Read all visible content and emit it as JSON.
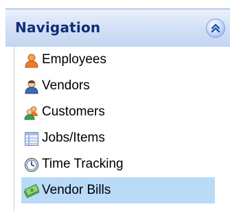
{
  "header": {
    "title": "Navigation",
    "collapse_icon": "double-chevron-up-icon"
  },
  "items": [
    {
      "label": "Employees",
      "icon": "person-orange-icon",
      "selected": false
    },
    {
      "label": "Vendors",
      "icon": "person-blue-icon",
      "selected": false
    },
    {
      "label": "Customers",
      "icon": "people-group-icon",
      "selected": false
    },
    {
      "label": "Jobs/Items",
      "icon": "list-table-icon",
      "selected": false
    },
    {
      "label": "Time Tracking",
      "icon": "clock-icon",
      "selected": false
    },
    {
      "label": "Vendor Bills",
      "icon": "money-bills-icon",
      "selected": true
    }
  ],
  "colors": {
    "header_text": "#0e2e7a",
    "selected_bg": "#b9dbf8"
  }
}
